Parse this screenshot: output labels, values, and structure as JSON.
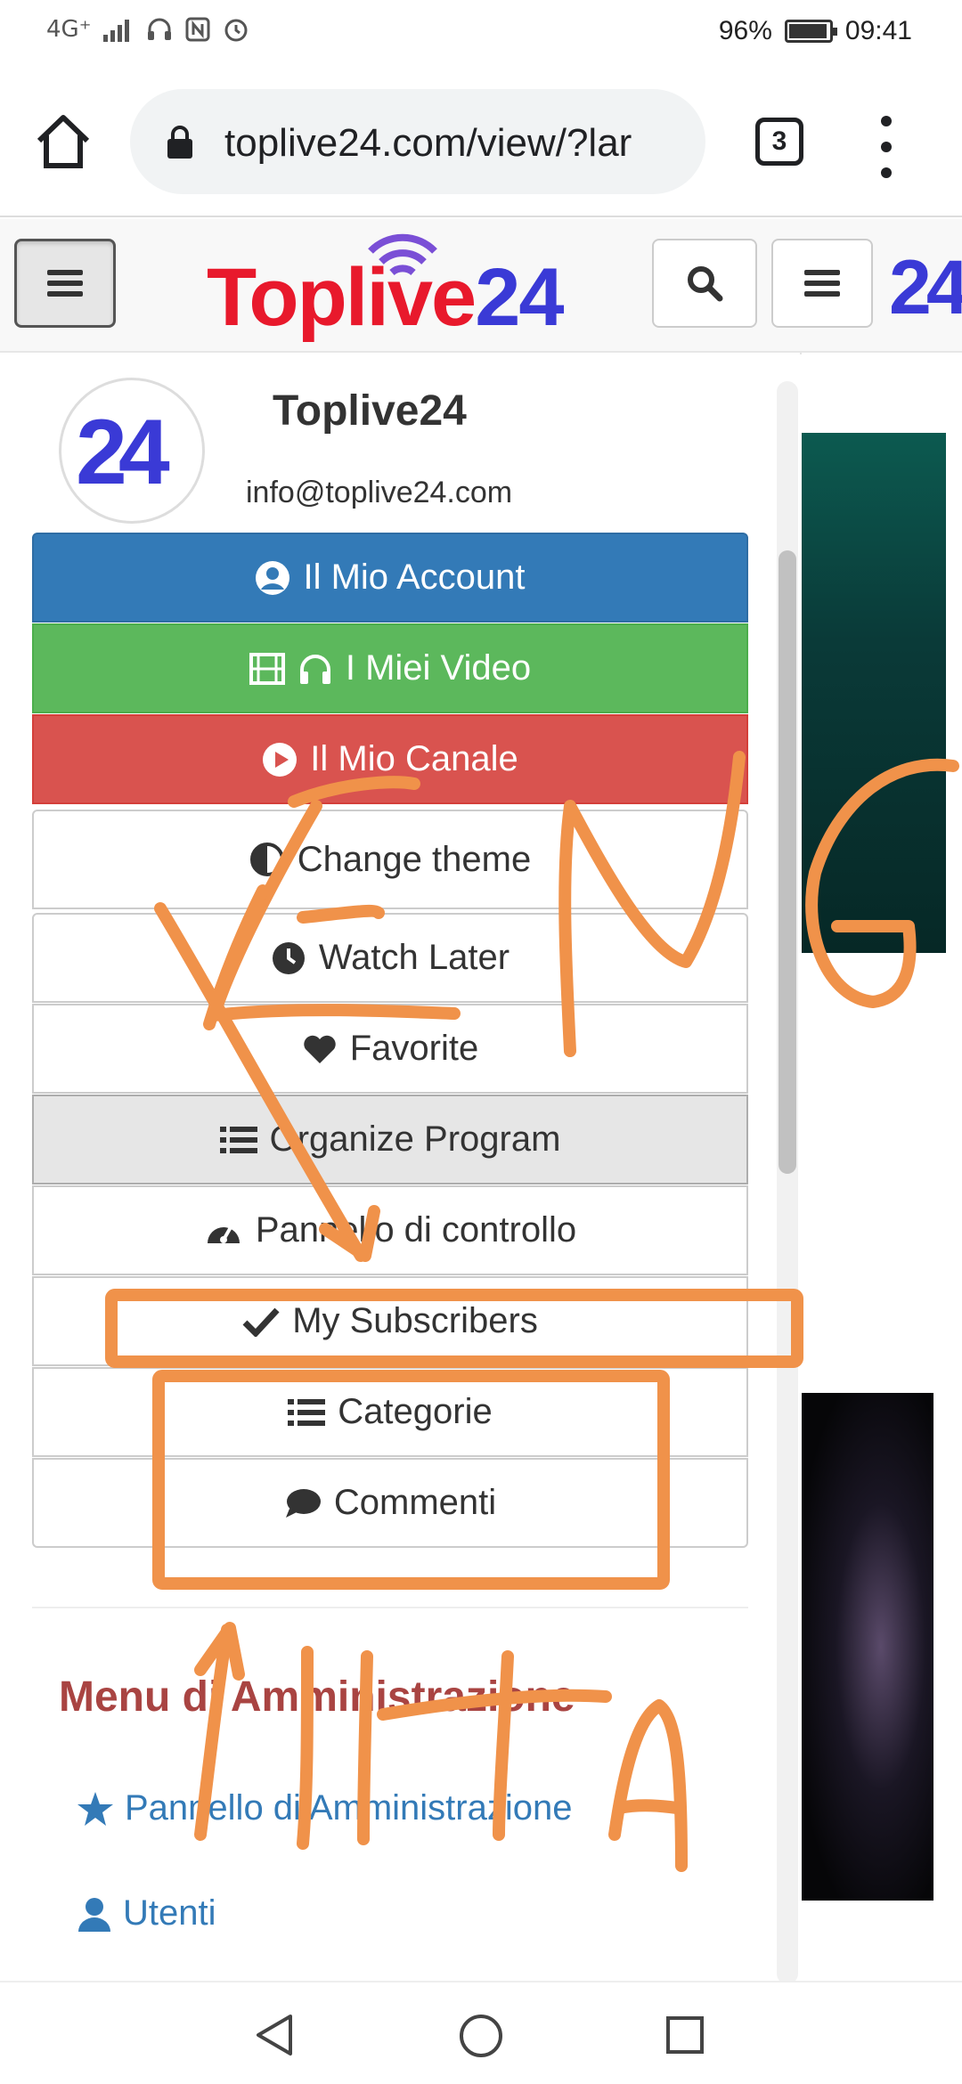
{
  "status_bar": {
    "network": "4G⁺",
    "battery_percent": "96%",
    "battery_level": 0.96,
    "time": "09:41",
    "icons": [
      "signal-icon",
      "headset-icon",
      "nfc-icon",
      "alarm-icon"
    ]
  },
  "browser": {
    "url": "toplive24.com/view/?lar",
    "tab_count": "3"
  },
  "header": {
    "logo_parts": [
      "Toplive",
      "24"
    ],
    "badge_text": "24",
    "colors": {
      "logo_red": "#e8192c",
      "logo_blue": "#3a3ad6",
      "wifi": "#7a4fd6"
    }
  },
  "profile": {
    "name": "Toplive24",
    "email": "info@toplive24.com",
    "avatar_text": "24"
  },
  "menu": {
    "my_account": "Il Mio Account",
    "my_videos": "I Miei Video",
    "my_channel": "Il Mio Canale",
    "change_theme": "Change theme",
    "watch_later": "Watch Later",
    "favorite": "Favorite",
    "organize_program": "Organize Program",
    "control_panel": "Pannello di controllo",
    "my_subscribers": "My Subscribers",
    "categories": "Categorie",
    "comments": "Commenti",
    "colors": {
      "blue": "#337ab7",
      "green": "#5cb85c",
      "red": "#d9534f"
    }
  },
  "admin": {
    "title": "Menu di Amministrazione",
    "admin_panel": "Pannello di Amministrazione",
    "users": "Utenti"
  },
  "annotations": {
    "color": "#f0924a",
    "words": [
      "ENG",
      "ITA"
    ]
  }
}
